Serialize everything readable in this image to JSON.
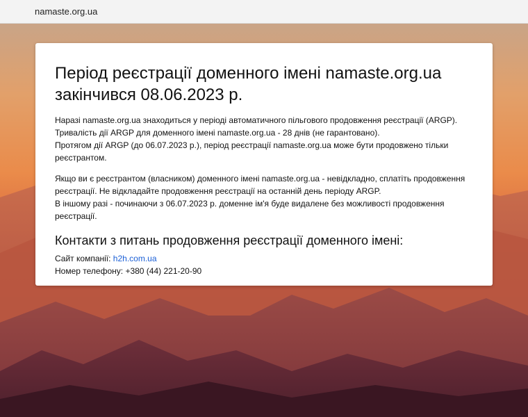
{
  "header": {
    "site_name": "namaste.org.ua"
  },
  "notice": {
    "title_line1": "Період реєстрації доменного імені namaste.org.ua",
    "title_line2": "закінчився 08.06.2023 р.",
    "paragraph1": [
      "Наразі namaste.org.ua знаходиться у періоді автоматичного пільгового продовження реєстрації (ARGP).",
      "Тривалість дії ARGP для доменного імені namaste.org.ua - 28 днів (не гарантовано).",
      "Протягом дії ARGP (до 06.07.2023 р.), період реєстрації namaste.org.ua може бути продовжено тільки реєстрантом."
    ],
    "paragraph2": [
      "Якщо ви є реєстрантом (власником) доменного імені namaste.org.ua - невідкладно, сплатіть продовження реєстрації. Не відкладайте продовження реєстрації на останній день періоду ARGP.",
      "В іншому разі - починаючи з 06.07.2023 р. доменне ім'я буде видалене без можливості продовження реєстрації."
    ]
  },
  "contacts": {
    "heading": "Контакти з питань продовження реєстрації доменного імені:",
    "site_label": "Сайт компанії:",
    "site_link": "h2h.com.ua",
    "phone_label": "Номер телефону:",
    "phone_value": "+380 (44) 221-20-90"
  }
}
